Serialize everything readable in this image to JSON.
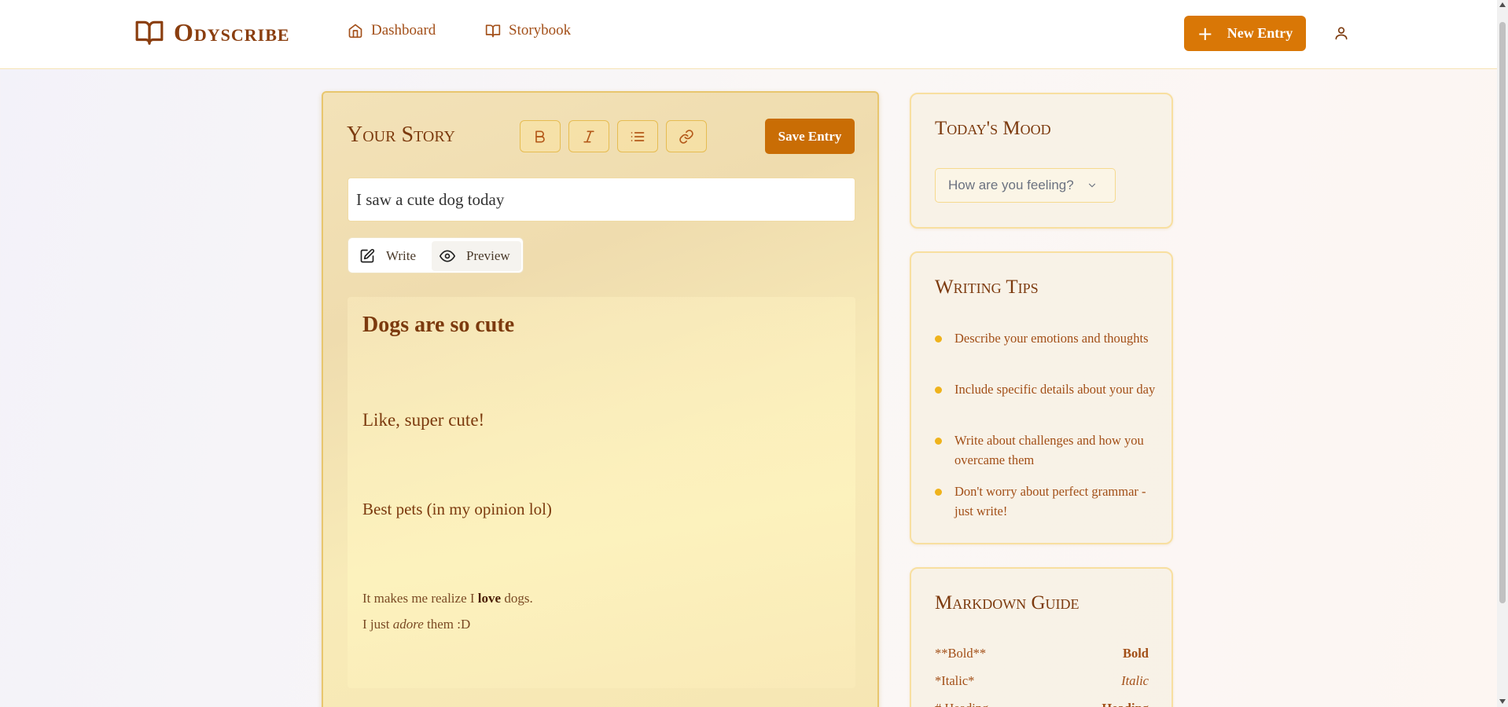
{
  "header": {
    "brand": "Odyscribe",
    "nav": [
      {
        "label": "Dashboard",
        "icon": "home-icon"
      },
      {
        "label": "Storybook",
        "icon": "book-open-icon"
      }
    ],
    "new_entry_label": "New Entry"
  },
  "editor": {
    "title": "Your Story",
    "toolbar": [
      "bold-icon",
      "italic-icon",
      "list-icon",
      "link-icon"
    ],
    "save_label": "Save Entry",
    "entry_title_value": "I saw a cute dog today",
    "modes": {
      "write": "Write",
      "preview": "Preview",
      "active": "preview"
    },
    "preview": {
      "h1": "Dogs are so cute",
      "h2": "Like, super cute!",
      "h3": "Best pets (in my opinion lol)",
      "p1_before": "It makes me realize I ",
      "p1_bold": "love",
      "p1_after": " dogs.",
      "p2_before": "I just ",
      "p2_italic": "adore",
      "p2_after": " them :D"
    }
  },
  "mood": {
    "title": "Today's Mood",
    "placeholder": "How are you feeling?"
  },
  "tips": {
    "title": "Writing Tips",
    "items": [
      "Describe your emotions and thoughts",
      "Include specific details about your day",
      "Write about challenges and how you overcame them",
      "Don't worry about perfect grammar - just write!"
    ]
  },
  "guide": {
    "title": "Markdown Guide",
    "rows": [
      {
        "syntax": "**Bold**",
        "result": "Bold"
      },
      {
        "syntax": "*Italic*",
        "result": "Italic"
      },
      {
        "syntax": "# Heading",
        "result": "Heading"
      }
    ]
  },
  "colors": {
    "accent": "#d97706",
    "brand": "#8a3e0f",
    "tip_dot": "#efb31c"
  }
}
